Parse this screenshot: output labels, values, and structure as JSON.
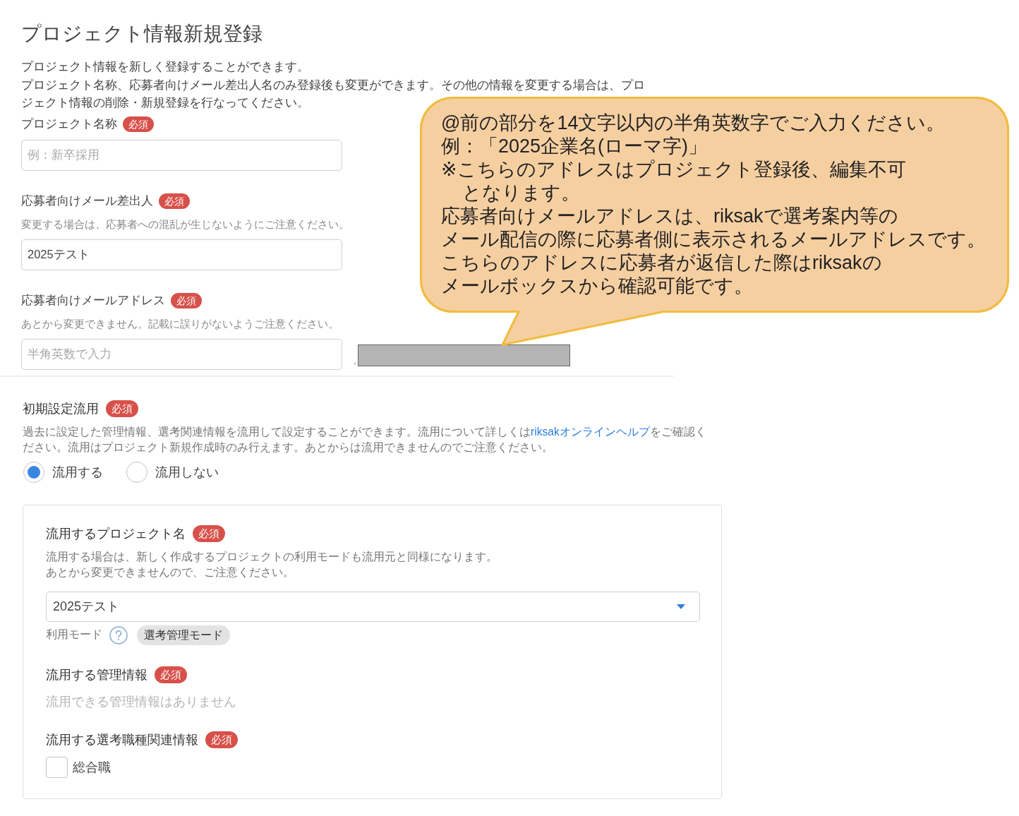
{
  "page": {
    "title": "プロジェクト情報新規登録",
    "intro": [
      "プロジェクト情報を新しく登録することができます。",
      "プロジェクト名称、応募者向けメール差出人名のみ登録後も変更ができます。その他の情報を変更する場合は、プロジェクト情報の削除・新規登録を行なってください。"
    ]
  },
  "fields": [
    {
      "kind": "text",
      "label": "プロジェクト名称",
      "badge": "必須",
      "placeholder": "例：新卒採用"
    },
    {
      "kind": "text",
      "label": "応募者向けメール差出人",
      "badge": "必須",
      "hint": "変更する場合は、応募者への混乱が生じないようにご注意ください。",
      "value": "2025テスト"
    },
    {
      "kind": "email",
      "label": "応募者向けメールアドレス",
      "badge": "必須",
      "hint": "あとから変更できません。記載に誤りがないようご注意ください。",
      "placeholder": "半角英数で入力",
      "suffix": "."
    }
  ],
  "reuse": {
    "label": "初期設定流用",
    "badge": "必須",
    "description": {
      "before": "過去に設定した管理情報、選考関連情報を流用して設定することができます。流用について詳しくは",
      "link": "riksakオンラインヘルプ",
      "after": "をご確認ください。流用はプロジェクト新規作成時のみ行えます。あとからは流用できませんのでご注意ください。"
    },
    "options": [
      {
        "label": "流用する",
        "selected": true
      },
      {
        "label": "流用しない",
        "selected": false
      }
    ],
    "panel": {
      "project": {
        "label": "流用するプロジェクト名",
        "badge": "必須",
        "hint": [
          "流用する場合は、新しく作成するプロジェクトの利用モードも流用元と同様になります。",
          "あとから変更できませんので、ご注意ください。"
        ],
        "value": "2025テスト",
        "mode_label": "利用モード",
        "mode": "選考管理モード"
      },
      "management": {
        "label": "流用する管理情報",
        "badge": "必須",
        "empty": "流用できる管理情報はありません"
      },
      "job_types": {
        "label": "流用する選考職種関連情報",
        "badge": "必須",
        "options": [
          {
            "label": "総合職",
            "checked": false
          }
        ]
      }
    }
  },
  "callout": {
    "lines": [
      {
        "kind": "line",
        "text": "@前の部分を14文字以内の半角英数字でご入力ください。"
      },
      {
        "kind": "line",
        "text": "例：「2025企業名(ローマ字)」"
      },
      {
        "kind": "line",
        "text": "※こちらのアドレスはプロジェクト登録後、編集不可"
      },
      {
        "kind": "continuation",
        "text": "となります。"
      },
      {
        "kind": "line",
        "text": "応募者向けメールアドレスは、riksakで選考案内等の"
      },
      {
        "kind": "line",
        "text": "メール配信の際に応募者側に表示されるメールアドレスです。"
      },
      {
        "kind": "line",
        "text": "こちらのアドレスに応募者が返信した際はriksakの"
      },
      {
        "kind": "line",
        "text": "メールボックスから確認可能です。"
      }
    ]
  }
}
